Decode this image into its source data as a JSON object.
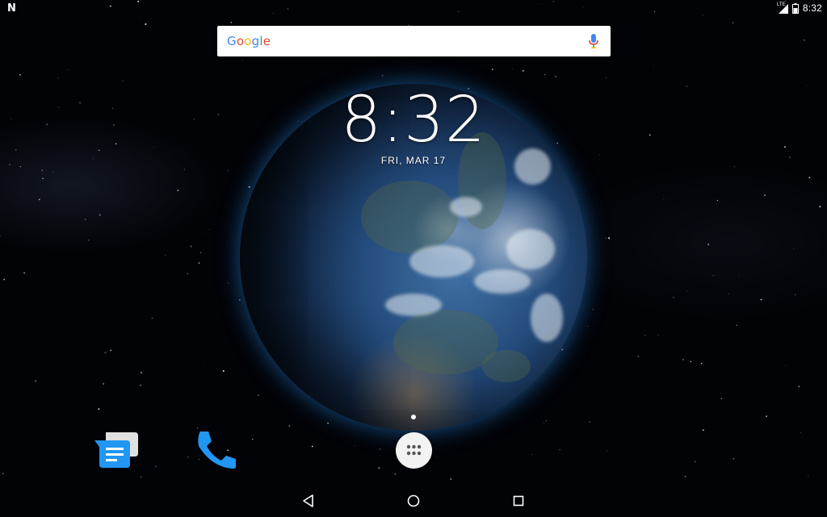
{
  "status_bar": {
    "notification_icon": "n-logo-icon",
    "network_label": "LTE",
    "time": "8:32",
    "icons": [
      "signal-icon",
      "battery-icon"
    ]
  },
  "search": {
    "brand": "Google",
    "brand_colors": [
      "#4285F4",
      "#EA4335",
      "#FBBC05",
      "#4285F4",
      "#34A853",
      "#EA4335"
    ],
    "mic_icon": "mic-icon"
  },
  "clock_widget": {
    "time": "8:32",
    "date": "FRI, MAR 17"
  },
  "wallpaper": {
    "subject": "earth-globe"
  },
  "dock": {
    "apps": [
      {
        "name": "messages-app-icon",
        "color": "#2196F3"
      },
      {
        "name": "phone-app-icon",
        "color": "#2196F3"
      }
    ],
    "all_apps_icon": "apps-grid-icon",
    "page_indicator_count": 1
  },
  "navigation": {
    "buttons": [
      "back-icon",
      "home-icon",
      "recents-icon"
    ]
  }
}
